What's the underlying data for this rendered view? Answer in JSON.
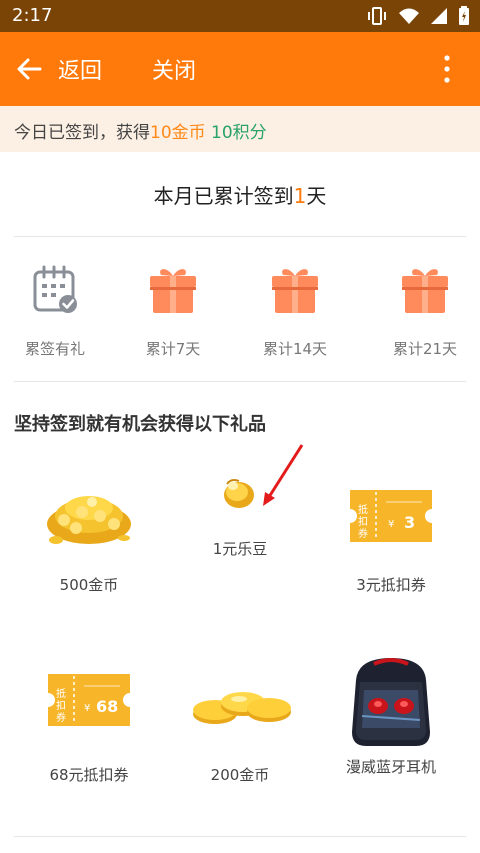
{
  "status": {
    "time": "2:17"
  },
  "toolbar": {
    "back_label": "返回",
    "close_label": "关闭"
  },
  "notice": {
    "prefix": "今日已签到，获得",
    "coins": "10金币",
    "points": "10积分"
  },
  "month": {
    "prefix": "本月已累计签到",
    "count": "1",
    "suffix": "天"
  },
  "rewards": [
    {
      "label": "累签有礼",
      "icon": "calendar-check-icon"
    },
    {
      "label": "累计7天",
      "icon": "gift-box-icon"
    },
    {
      "label": "累计14天",
      "icon": "gift-box-icon"
    },
    {
      "label": "累计21天",
      "icon": "gift-box-icon"
    }
  ],
  "gifts_title": "坚持签到就有机会获得以下礼品",
  "gifts": [
    {
      "label": "500金币",
      "icon": "gold-coin-pile-icon"
    },
    {
      "label": "1元乐豆",
      "icon": "golden-bean-icon"
    },
    {
      "label": "3元抵扣券",
      "icon": "coupon-icon",
      "coupon_value": "3",
      "coupon_tag": "抵扣券"
    },
    {
      "label": "68元抵扣券",
      "icon": "coupon-icon",
      "coupon_value": "68",
      "coupon_tag": "抵扣券"
    },
    {
      "label": "200金币",
      "icon": "gold-coins-icon"
    },
    {
      "label": "漫威蓝牙耳机",
      "icon": "earphones-case-icon"
    }
  ],
  "colors": {
    "toolbar": "#ff7a0a",
    "status_bar": "#7a4407",
    "accent_orange": "#ff8a1a",
    "accent_green": "#29a36a",
    "gift_box": "#ff8a5c"
  }
}
